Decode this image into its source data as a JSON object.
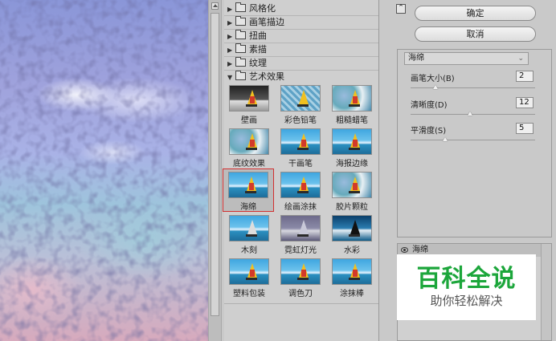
{
  "categories": [
    {
      "label": "风格化",
      "expanded": false
    },
    {
      "label": "画笔描边",
      "expanded": false
    },
    {
      "label": "扭曲",
      "expanded": false
    },
    {
      "label": "素描",
      "expanded": false
    },
    {
      "label": "纹理",
      "expanded": false
    },
    {
      "label": "艺术效果",
      "expanded": true
    }
  ],
  "filters": [
    {
      "label": "壁画"
    },
    {
      "label": "彩色铅笔"
    },
    {
      "label": "粗糙蜡笔"
    },
    {
      "label": "底纹效果"
    },
    {
      "label": "干画笔"
    },
    {
      "label": "海报边缘"
    },
    {
      "label": "海绵",
      "selected": true
    },
    {
      "label": "绘画涂抹"
    },
    {
      "label": "胶片颗粒"
    },
    {
      "label": "木刻"
    },
    {
      "label": "霓虹灯光"
    },
    {
      "label": "水彩"
    },
    {
      "label": "塑料包装"
    },
    {
      "label": "调色刀"
    },
    {
      "label": "涂抹棒"
    }
  ],
  "buttons": {
    "ok": "确定",
    "cancel": "取消"
  },
  "filter_select": {
    "value": "海绵"
  },
  "params": [
    {
      "label": "画笔大小(B)",
      "value": "2",
      "slider_fraction": 0.2
    },
    {
      "label": "清晰度(D)",
      "value": "12",
      "slider_fraction": 0.48
    },
    {
      "label": "平滑度(S)",
      "value": "5",
      "slider_fraction": 0.28
    }
  ],
  "layers": [
    {
      "name": "海绵",
      "visible": true
    }
  ],
  "watermark": {
    "title": "百科全说",
    "subtitle": "助你轻松解决"
  },
  "icons": {
    "collapse": "collapse-icon",
    "eye": "eye-icon",
    "folder": "folder-icon"
  }
}
